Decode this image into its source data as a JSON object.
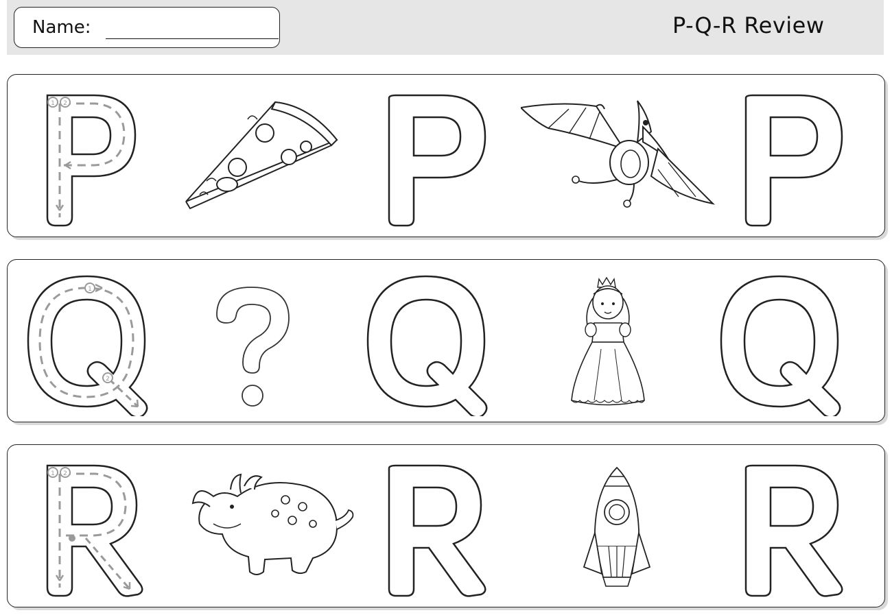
{
  "header": {
    "name_label": "Name:",
    "title": "P-Q-R  Review"
  },
  "rows": [
    {
      "letter": "P",
      "items": [
        {
          "type": "traced-letter",
          "letter": "P",
          "icon": "pizza-slice-icon"
        },
        {
          "type": "picture",
          "icon": "pizza-slice-icon"
        },
        {
          "type": "outline-letter",
          "letter": "P"
        },
        {
          "type": "picture",
          "icon": "pterodactyl-icon"
        },
        {
          "type": "outline-letter",
          "letter": "P"
        }
      ]
    },
    {
      "letter": "Q",
      "items": [
        {
          "type": "traced-letter",
          "letter": "Q"
        },
        {
          "type": "picture",
          "icon": "question-mark-icon"
        },
        {
          "type": "outline-letter",
          "letter": "Q"
        },
        {
          "type": "picture",
          "icon": "queen-icon"
        },
        {
          "type": "outline-letter",
          "letter": "Q"
        }
      ]
    },
    {
      "letter": "R",
      "items": [
        {
          "type": "traced-letter",
          "letter": "R"
        },
        {
          "type": "picture",
          "icon": "rhino-icon"
        },
        {
          "type": "outline-letter",
          "letter": "R"
        },
        {
          "type": "picture",
          "icon": "rocket-icon"
        },
        {
          "type": "outline-letter",
          "letter": "R"
        }
      ]
    }
  ],
  "trace_numbers": [
    "1",
    "2"
  ],
  "colors": {
    "outline": "#222222",
    "trace": "#9a9a9a",
    "header_band": "#e6e6e6"
  }
}
